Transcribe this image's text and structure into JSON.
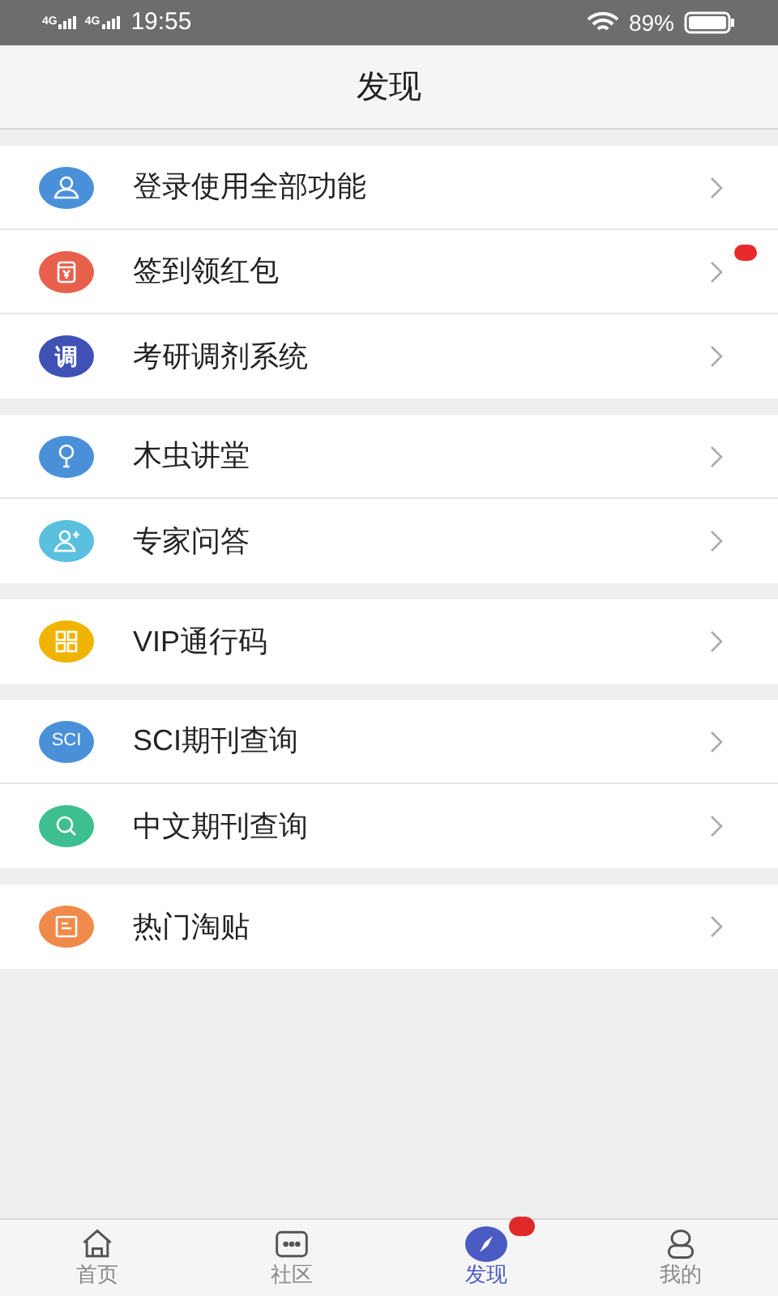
{
  "status_bar": {
    "networks": [
      "4G",
      "4G"
    ],
    "time": "19:55",
    "battery": "89%"
  },
  "header": {
    "title": "发现"
  },
  "sections": [
    {
      "items": [
        {
          "label": "登录使用全部功能",
          "kind": "user",
          "color": "#4a90d9",
          "badge": false
        },
        {
          "label": "签到领红包",
          "kind": "gift",
          "color": "#e8604c",
          "badge": true
        },
        {
          "label": "考研调剂系统",
          "kind": "text",
          "icon_text": "调",
          "color": "#3f51b5",
          "badge": false
        }
      ]
    },
    {
      "items": [
        {
          "label": "木虫讲堂",
          "kind": "bulb",
          "color": "#4a90d9",
          "badge": false
        },
        {
          "label": "专家问答",
          "kind": "user-plus",
          "color": "#5bc0de",
          "badge": false
        }
      ]
    },
    {
      "items": [
        {
          "label": "VIP通行码",
          "kind": "grid",
          "color": "#f0b400",
          "badge": false
        }
      ]
    },
    {
      "items": [
        {
          "label": "SCI期刊查询",
          "kind": "text",
          "icon_text": "SCI",
          "color": "#4a90d9",
          "badge": false
        },
        {
          "label": "中文期刊查询",
          "kind": "search",
          "color": "#3dbf8f",
          "badge": false
        }
      ]
    },
    {
      "items": [
        {
          "label": "热门淘贴",
          "kind": "note",
          "color": "#f08a4b",
          "badge": false
        }
      ]
    }
  ],
  "tabs": [
    {
      "label": "首页",
      "kind": "home",
      "selected": false,
      "badge": false
    },
    {
      "label": "社区",
      "kind": "chat",
      "selected": false,
      "badge": false
    },
    {
      "label": "发现",
      "kind": "compass",
      "selected": true,
      "badge": true
    },
    {
      "label": "我的",
      "kind": "person",
      "selected": false,
      "badge": false
    }
  ]
}
